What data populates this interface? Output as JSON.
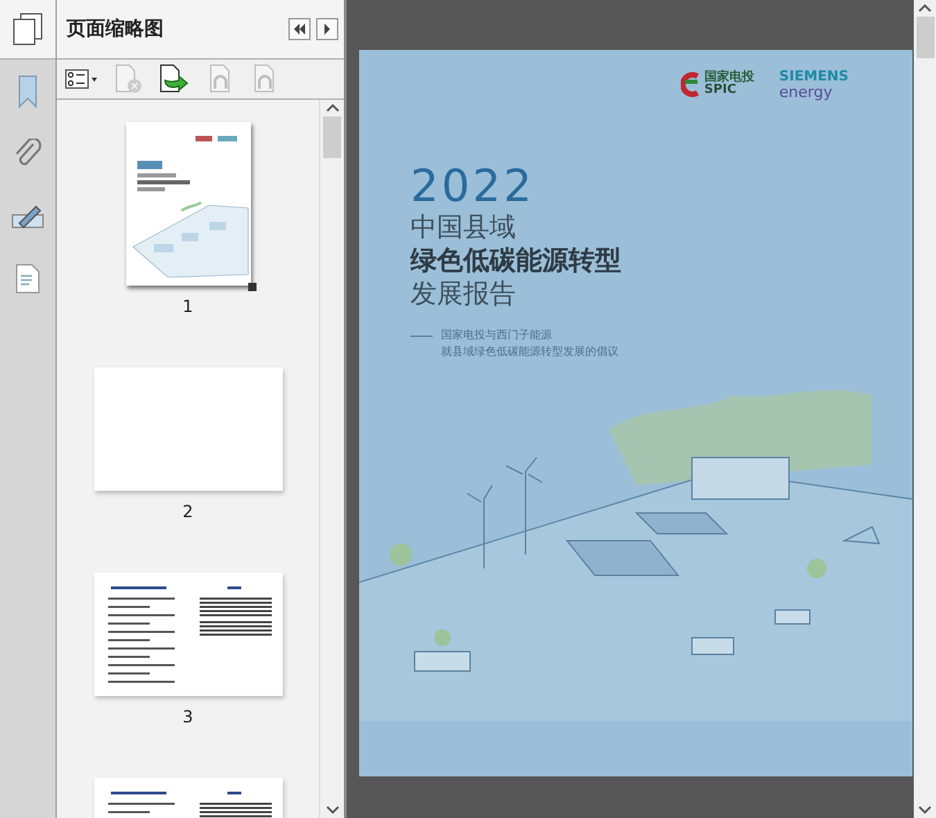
{
  "panel": {
    "title": "页面缩略图",
    "nav_buttons": [
      {
        "kind": "first"
      },
      {
        "kind": "next"
      }
    ]
  },
  "rail": [
    {
      "kind": "bookmark",
      "selected": false
    },
    {
      "kind": "attachment",
      "selected": false
    },
    {
      "kind": "signature",
      "selected": false
    },
    {
      "kind": "layers",
      "selected": false
    }
  ],
  "toolbar": [
    {
      "kind": "options",
      "disabled": false
    },
    {
      "kind": "delete",
      "disabled": true
    },
    {
      "kind": "insert",
      "disabled": false
    },
    {
      "kind": "rotate-left",
      "disabled": true
    },
    {
      "kind": "rotate-right",
      "disabled": true
    }
  ],
  "thumbnails": [
    {
      "label": "1",
      "kind": "cover",
      "selected": true
    },
    {
      "label": "2",
      "kind": "blank",
      "selected": false
    },
    {
      "label": "3",
      "kind": "text",
      "selected": false
    },
    {
      "kind": "text",
      "selected": false
    }
  ],
  "cover": {
    "logos": [
      {
        "kind": "spic",
        "name": "国家电投",
        "abbr": "SPIC"
      },
      {
        "kind": "siemens",
        "name": "SIEMENS",
        "sub": "energy"
      }
    ],
    "year": "2022",
    "title_lines": [
      {
        "text": "中国县域",
        "bold": false
      },
      {
        "text": "绿色低碳能源转型",
        "bold": true
      },
      {
        "text": "发展报告",
        "bold": false
      }
    ],
    "subtitle_lines": [
      "国家电投与西门子能源",
      "就县域绿色低碳能源转型发展的倡议"
    ]
  }
}
